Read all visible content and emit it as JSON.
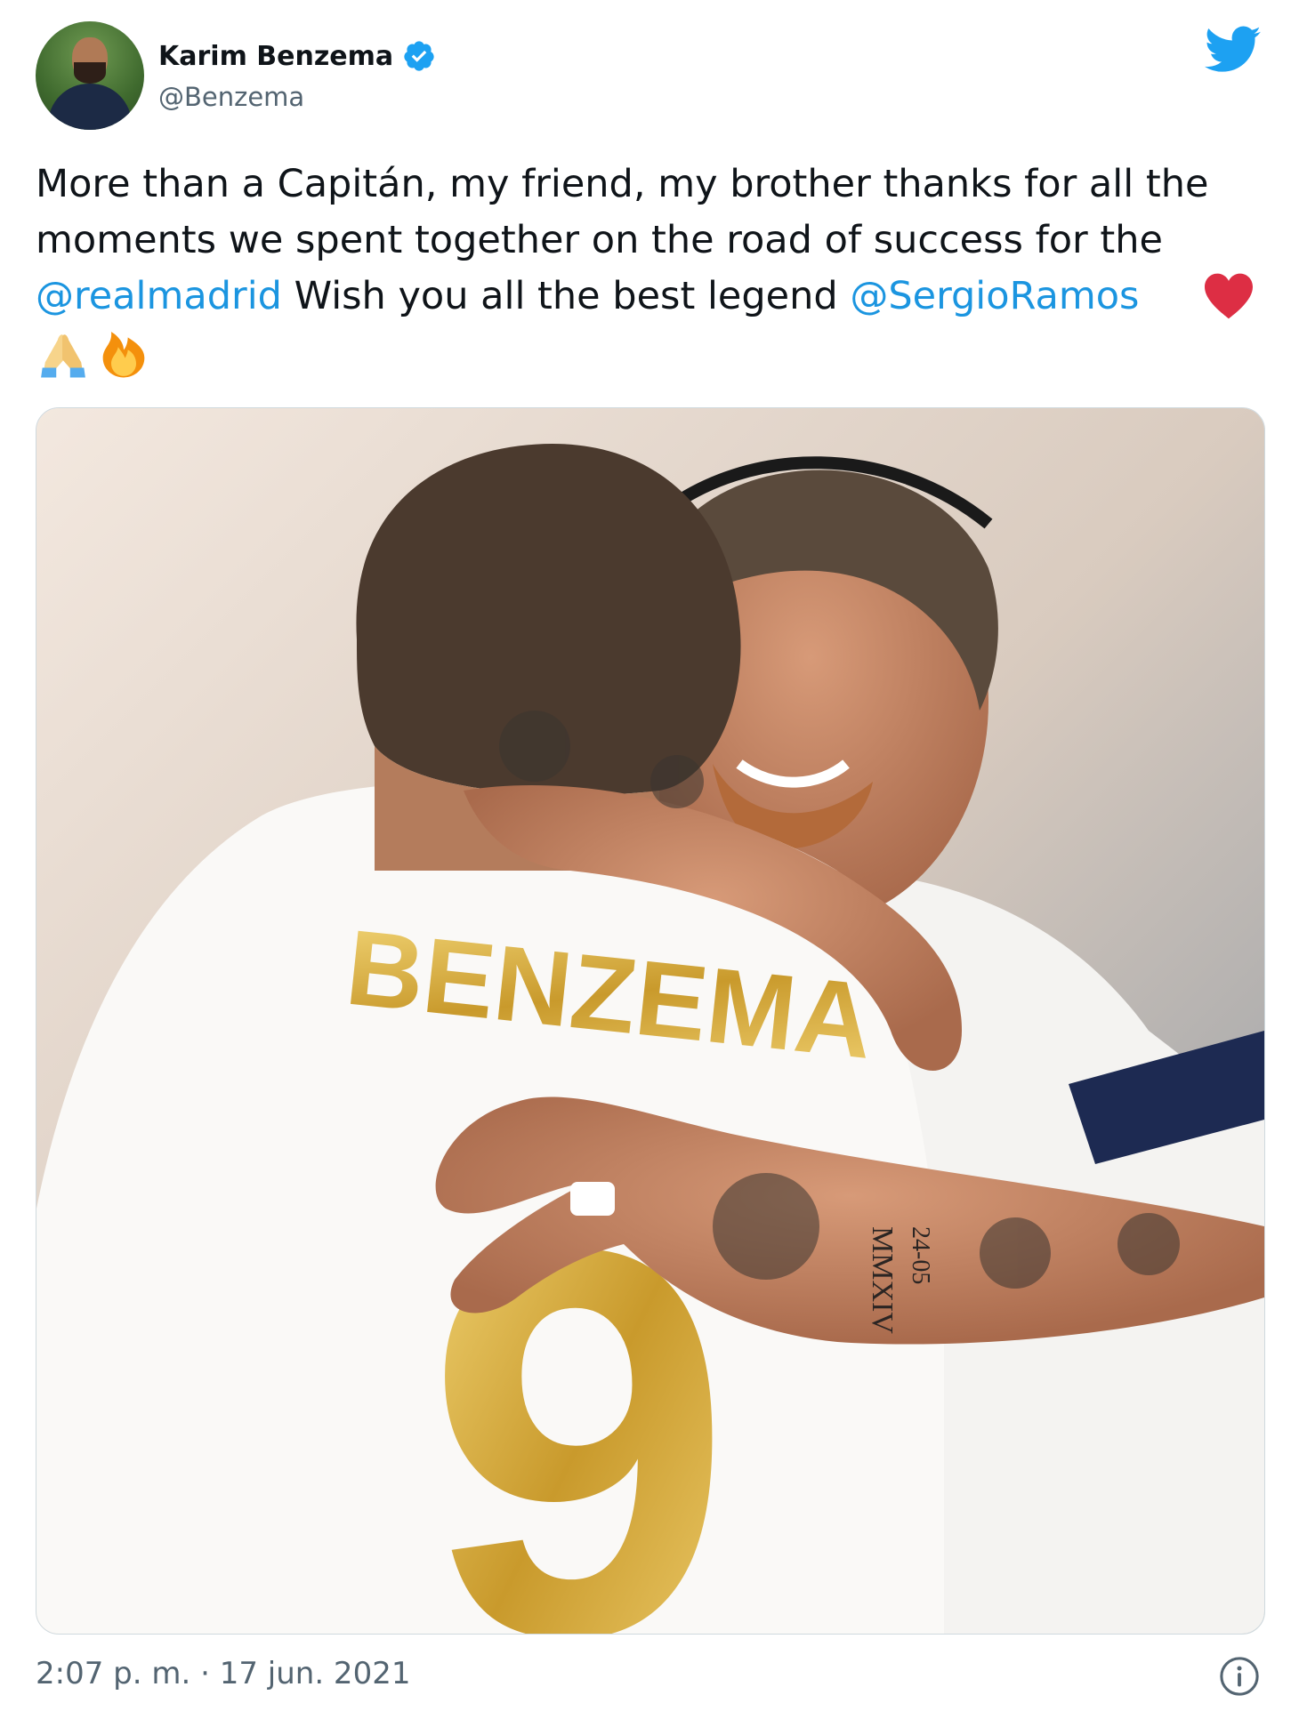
{
  "author": {
    "name": "Karim Benzema",
    "handle": "@Benzema",
    "verified": true
  },
  "tweet": {
    "text_part1": "More than a Capitán, my friend, my brother thanks for all the moments we spent together on the road of success for the ",
    "mention1": "@realmadrid",
    "text_part2": " Wish you all the best legend ",
    "mention2": "@SergioRamos",
    "emojis": [
      "red-heart",
      "folded-hands",
      "fire"
    ]
  },
  "media": {
    "jersey_name": "BENZEMA",
    "jersey_number": "9",
    "tattoo_text": "MMXIV",
    "tattoo_date": "24-05"
  },
  "footer": {
    "timestamp": "2:07 p. m. · 17 jun. 2021"
  },
  "colors": {
    "mention": "#1b95e0",
    "twitter_blue": "#1da1f2",
    "heart": "#e0245e"
  },
  "icons": {
    "brand": "twitter-bird-icon",
    "verified": "verified-badge-icon",
    "info": "info-icon"
  }
}
